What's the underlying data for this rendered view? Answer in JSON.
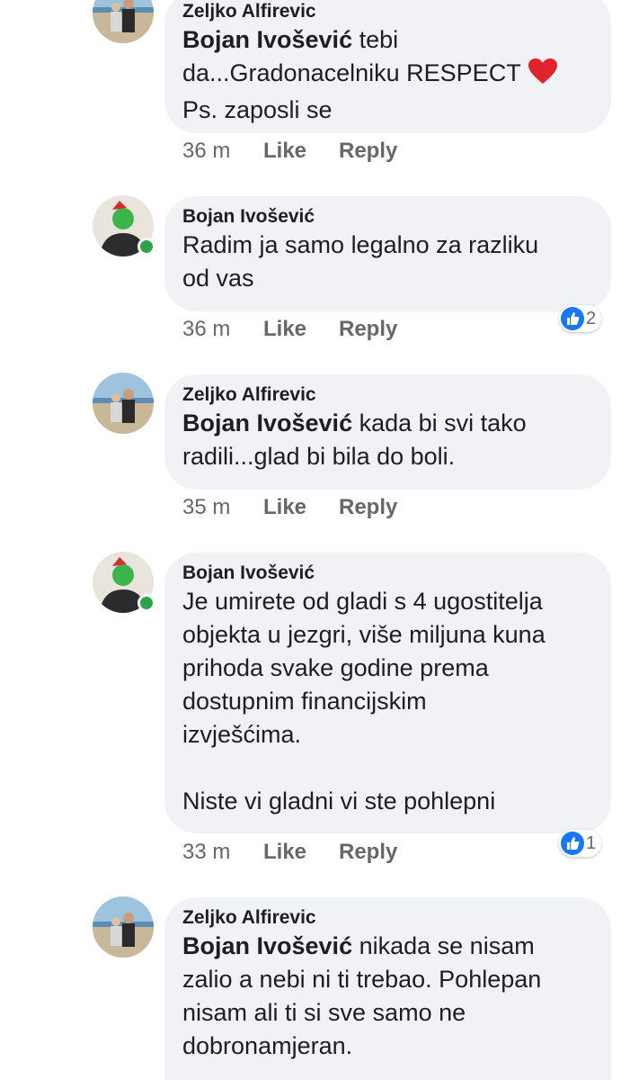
{
  "comments": [
    {
      "author": "Zeljko Alfirevic",
      "mention": "Bojan Ivošević",
      "text_lines": [
        " tebi",
        "da...Gradonacelniku RESPECT",
        "Ps. zaposli se"
      ],
      "time": "36 m",
      "like": "Like",
      "reply": "Reply"
    },
    {
      "author": "Bojan Ivošević",
      "text_lines": [
        "Radim ja samo legalno za razliku",
        "od vas"
      ],
      "time": "36 m",
      "like": "Like",
      "reply": "Reply",
      "reaction_count": "2"
    },
    {
      "author": "Zeljko Alfirevic",
      "mention": "Bojan Ivošević",
      "text_lines": [
        " kada bi svi tako",
        "radili...glad bi bila do boli."
      ],
      "time": "35 m",
      "like": "Like",
      "reply": "Reply"
    },
    {
      "author": "Bojan Ivošević",
      "text_lines": [
        "Je umirete od gladi s 4 ugostitelja",
        "objekta u jezgri, više miljuna kuna",
        "prihoda svake godine prema",
        "dostupnim financijskim",
        "izvješćima.",
        "",
        "Niste vi gladni vi ste pohlepni"
      ],
      "time": "33 m",
      "like": "Like",
      "reply": "Reply",
      "reaction_count": "1"
    },
    {
      "author": "Zeljko Alfirevic",
      "mention": "Bojan Ivošević",
      "text_lines": [
        " nikada se nisam",
        "zalio a nebi ni ti trebao. Pohlepan",
        "nisam ali ti si sve samo ne",
        "dobronamjeran."
      ]
    }
  ],
  "icons": {
    "reaction": "like-icon",
    "emoji": "red-heart-emoji",
    "presence": "online-indicator"
  },
  "colors": {
    "bubble": "#f0f2f5",
    "like_blue": "#1877f2",
    "online": "#31a24c",
    "meta": "#65676b"
  }
}
